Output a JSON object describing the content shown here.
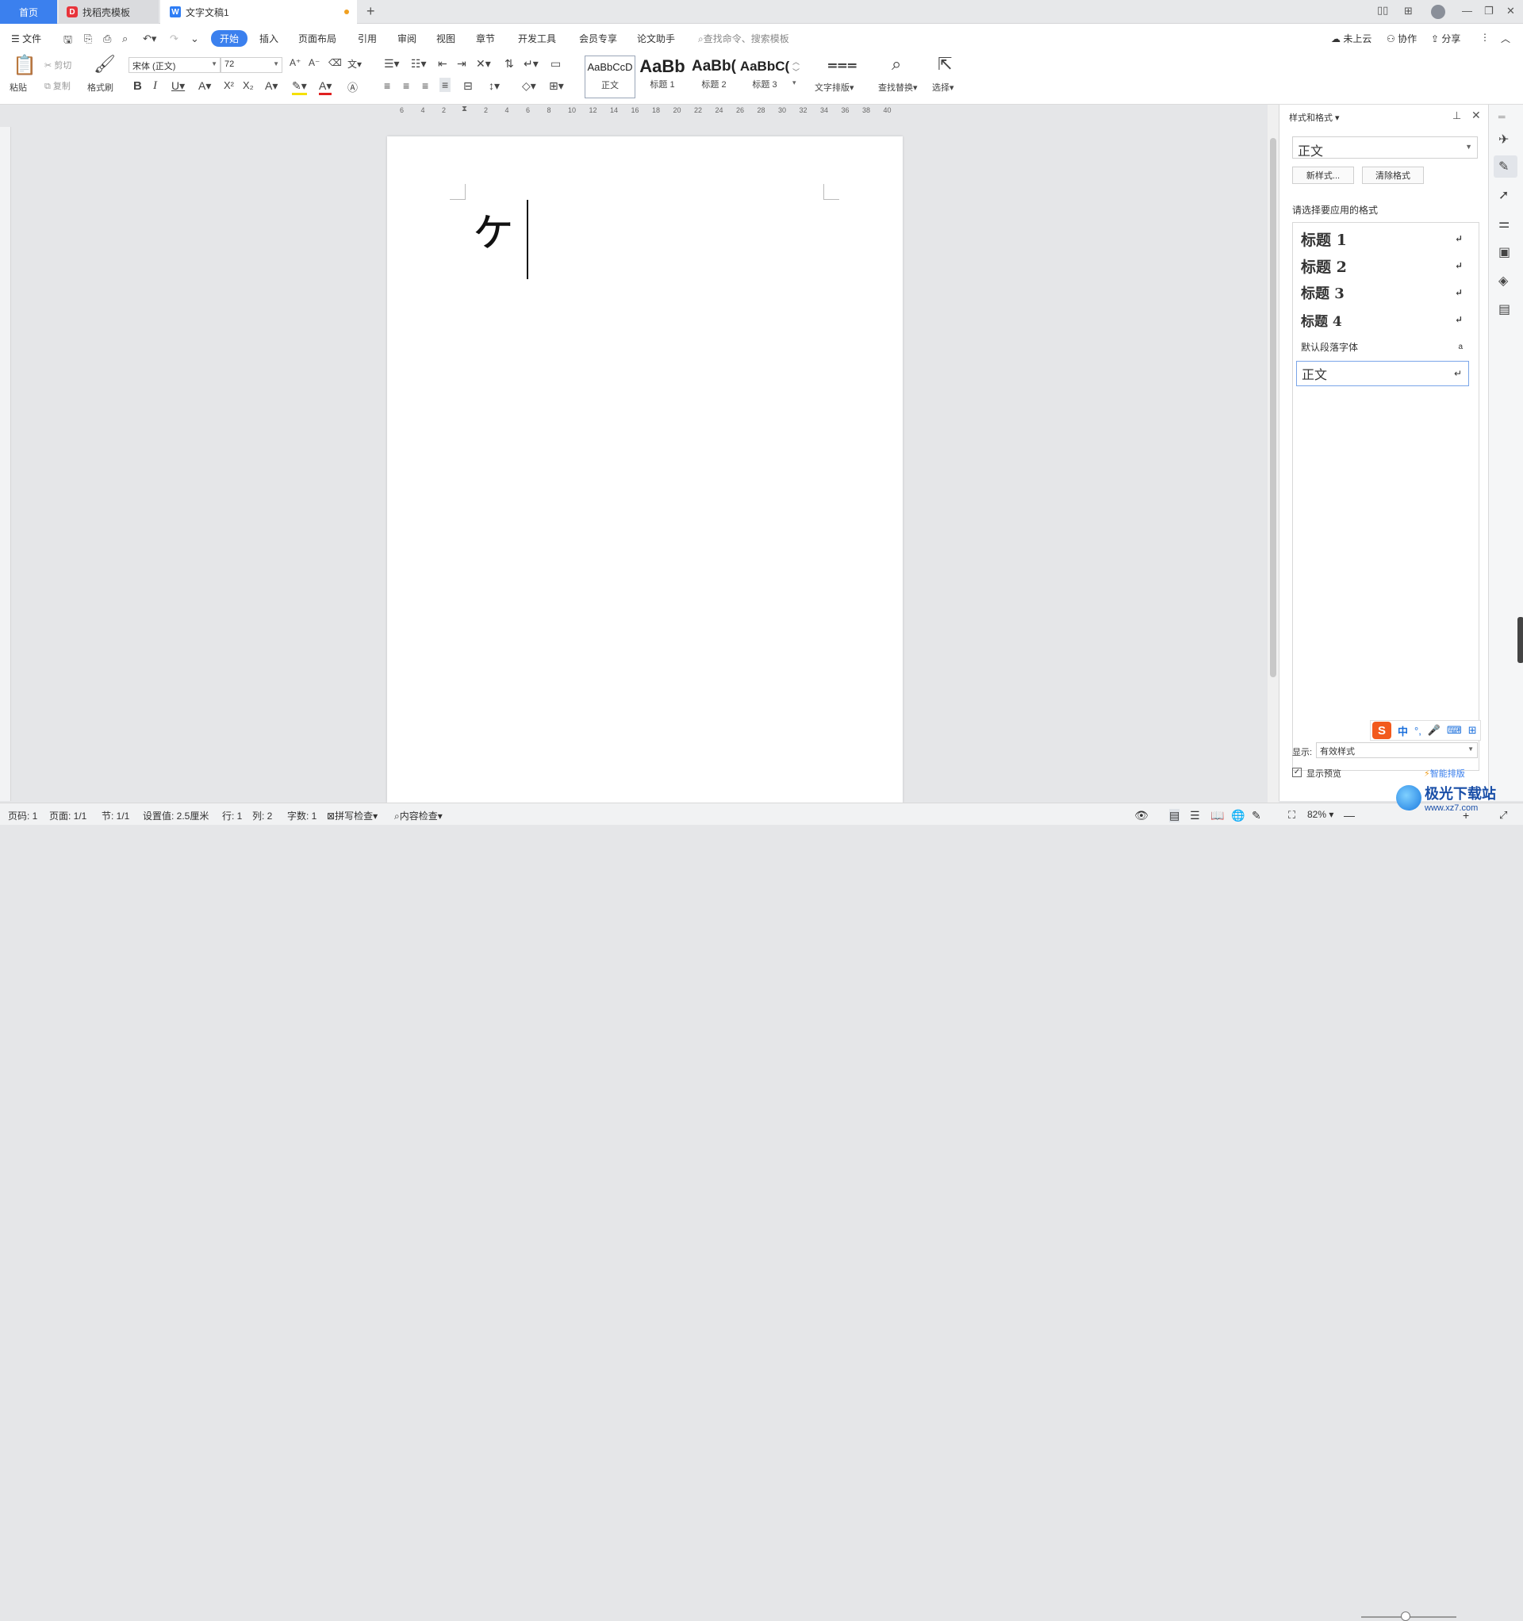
{
  "tabs": {
    "home": "首页",
    "template": "找稻壳模板",
    "document": "文字文稿1",
    "new_tab": "+"
  },
  "menu": {
    "file": "文件",
    "items": [
      "开始",
      "插入",
      "页面布局",
      "引用",
      "审阅",
      "视图",
      "章节",
      "开发工具",
      "会员专享",
      "论文助手"
    ],
    "search_placeholder": "查找命令、搜索模板",
    "cloud": "未上云",
    "collab": "协作",
    "share": "分享"
  },
  "ribbon": {
    "paste": "粘贴",
    "cut": "剪切",
    "copy": "复制",
    "format_painter": "格式刷",
    "font_name": "宋体 (正文)",
    "font_size": "72",
    "styles": [
      {
        "preview": "AaBbCcD",
        "label": "正文"
      },
      {
        "preview": "AaBb",
        "label": "标题 1"
      },
      {
        "preview": "AaBb(",
        "label": "标题 2"
      },
      {
        "preview": "AaBbC(",
        "label": "标题 3"
      }
    ],
    "text_layout": "文字排版",
    "find_replace": "查找替换",
    "select": "选择"
  },
  "ruler_ticks": [
    "6",
    "4",
    "2",
    "",
    "2",
    "4",
    "6",
    "8",
    "10",
    "12",
    "14",
    "16",
    "18",
    "20",
    "22",
    "24",
    "26",
    "28",
    "30",
    "32",
    "34",
    "36",
    "38",
    "40"
  ],
  "document": {
    "text": "ヶ"
  },
  "pane": {
    "title": "样式和格式",
    "current_style": "正文",
    "new_style": "新样式...",
    "clear_format": "清除格式",
    "prompt": "请选择要应用的格式",
    "styles": [
      {
        "name": "标题  1",
        "mark": "↵"
      },
      {
        "name": "标题  2",
        "mark": "↵"
      },
      {
        "name": "标题  3",
        "mark": "↵"
      },
      {
        "name": "标题  4",
        "mark": "↵"
      },
      {
        "name": "默认段落字体",
        "mark": "a"
      },
      {
        "name": "正文",
        "mark": "↵"
      }
    ],
    "show_label": "显示:",
    "show_value": "有效样式",
    "show_preview": "显示预览",
    "smart_layout": "智能排版"
  },
  "ime": {
    "mode": "中"
  },
  "status": {
    "page_num": "页码: 1",
    "pages": "页面: 1/1",
    "section": "节: 1/1",
    "setting": "设置值: 2.5厘米",
    "line": "行: 1",
    "col": "列: 2",
    "words": "字数: 1",
    "spell": "拼写检查",
    "content_check": "内容检查",
    "zoom": "82%"
  },
  "watermark": {
    "site_name": "极光下载站",
    "site_url": "www.xz7.com"
  }
}
